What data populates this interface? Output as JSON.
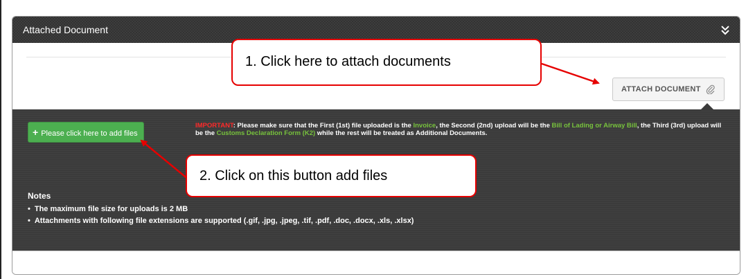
{
  "panel": {
    "title": "Attached Document",
    "attach_button_label": "ATTACH DOCUMENT",
    "add_files_button_label": "Please click here to add files",
    "important": {
      "label": "IMPORTANT",
      "text_1": ": Please make sure that the First (1st) file uploaded is the ",
      "invoice": "Invoice",
      "text_2": ", the Second (2nd) upload will be the ",
      "bill": "Bill of Lading or Airway Bill",
      "text_3": ", the Third (3rd) upload will be the ",
      "customs": "Customs Declaration Form (K2)",
      "text_4": " while the rest will be treated as Additional Documents."
    },
    "notes": {
      "title": "Notes",
      "items": [
        "The maximum file size for uploads is 2 MB",
        "Attachments with following file extensions are supported (.gif, .jpg, .jpeg, .tif, .pdf, .doc, .docx, .xls, .xlsx)"
      ]
    }
  },
  "callouts": {
    "step1": "1. Click here to attach documents",
    "step2": "2. Click on this button add files"
  },
  "icons": {
    "collapse": "double-chevron-down-icon",
    "attach": "paperclip-icon",
    "add": "plus-icon"
  },
  "colors": {
    "callout_border": "#e60000",
    "add_button": "#4caf50",
    "important_red": "#ff2a2a",
    "highlight_green": "#77c23c"
  }
}
